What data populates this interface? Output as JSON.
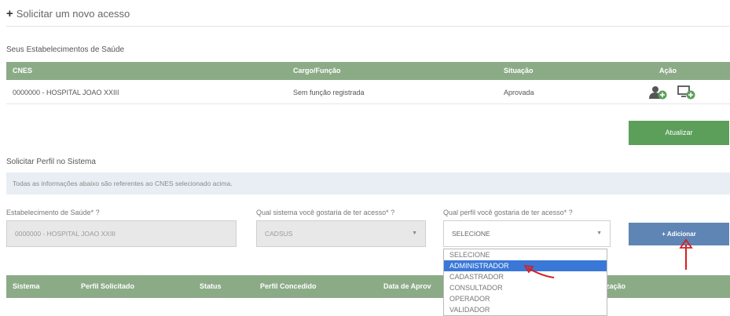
{
  "header": {
    "new_access_label": "Solicitar um novo acesso"
  },
  "establishments": {
    "title": "Seus Estabelecimentos de Saúde",
    "columns": [
      "CNES",
      "Cargo/Função",
      "Situação",
      "Ação"
    ],
    "rows": [
      {
        "cnes": "0000000 - HOSPITAL JOAO XXIII",
        "cargo": "Sem função registrada",
        "situacao": "Aprovada"
      }
    ],
    "update_button": "Atualizar"
  },
  "profile_request": {
    "title": "Solicitar Perfil no Sistema",
    "info": "Todas as informações abaixo são referentes ao CNES selecionado acima.",
    "establishment_label": "Estabelecimento de Saúde* ?",
    "establishment_value": "0000000 - HOSPITAL JOAO XXIII",
    "system_label": "Qual sistema você gostaria de ter acesso* ?",
    "system_value": "CADSUS",
    "profile_label": "Qual perfil você gostaria de ter acesso* ?",
    "profile_value": "SELECIONE",
    "add_button": "+ Adicionar",
    "profile_options": [
      "SELECIONE",
      "ADMINISTRADOR",
      "CADASTRADOR",
      "CONSULTADOR",
      "OPERADOR",
      "VALIDADOR"
    ],
    "highlighted_option": "ADMINISTRADOR"
  },
  "requests_table": {
    "columns": [
      "Sistema",
      "Perfil Solicitado",
      "Status",
      "Perfil Concedido",
      "Data de Aprov",
      "rização"
    ]
  },
  "colors": {
    "table_header": "#8bab87",
    "update_button": "#5c9f5b",
    "add_button": "#5f85b4",
    "annotation": "#d62020"
  }
}
